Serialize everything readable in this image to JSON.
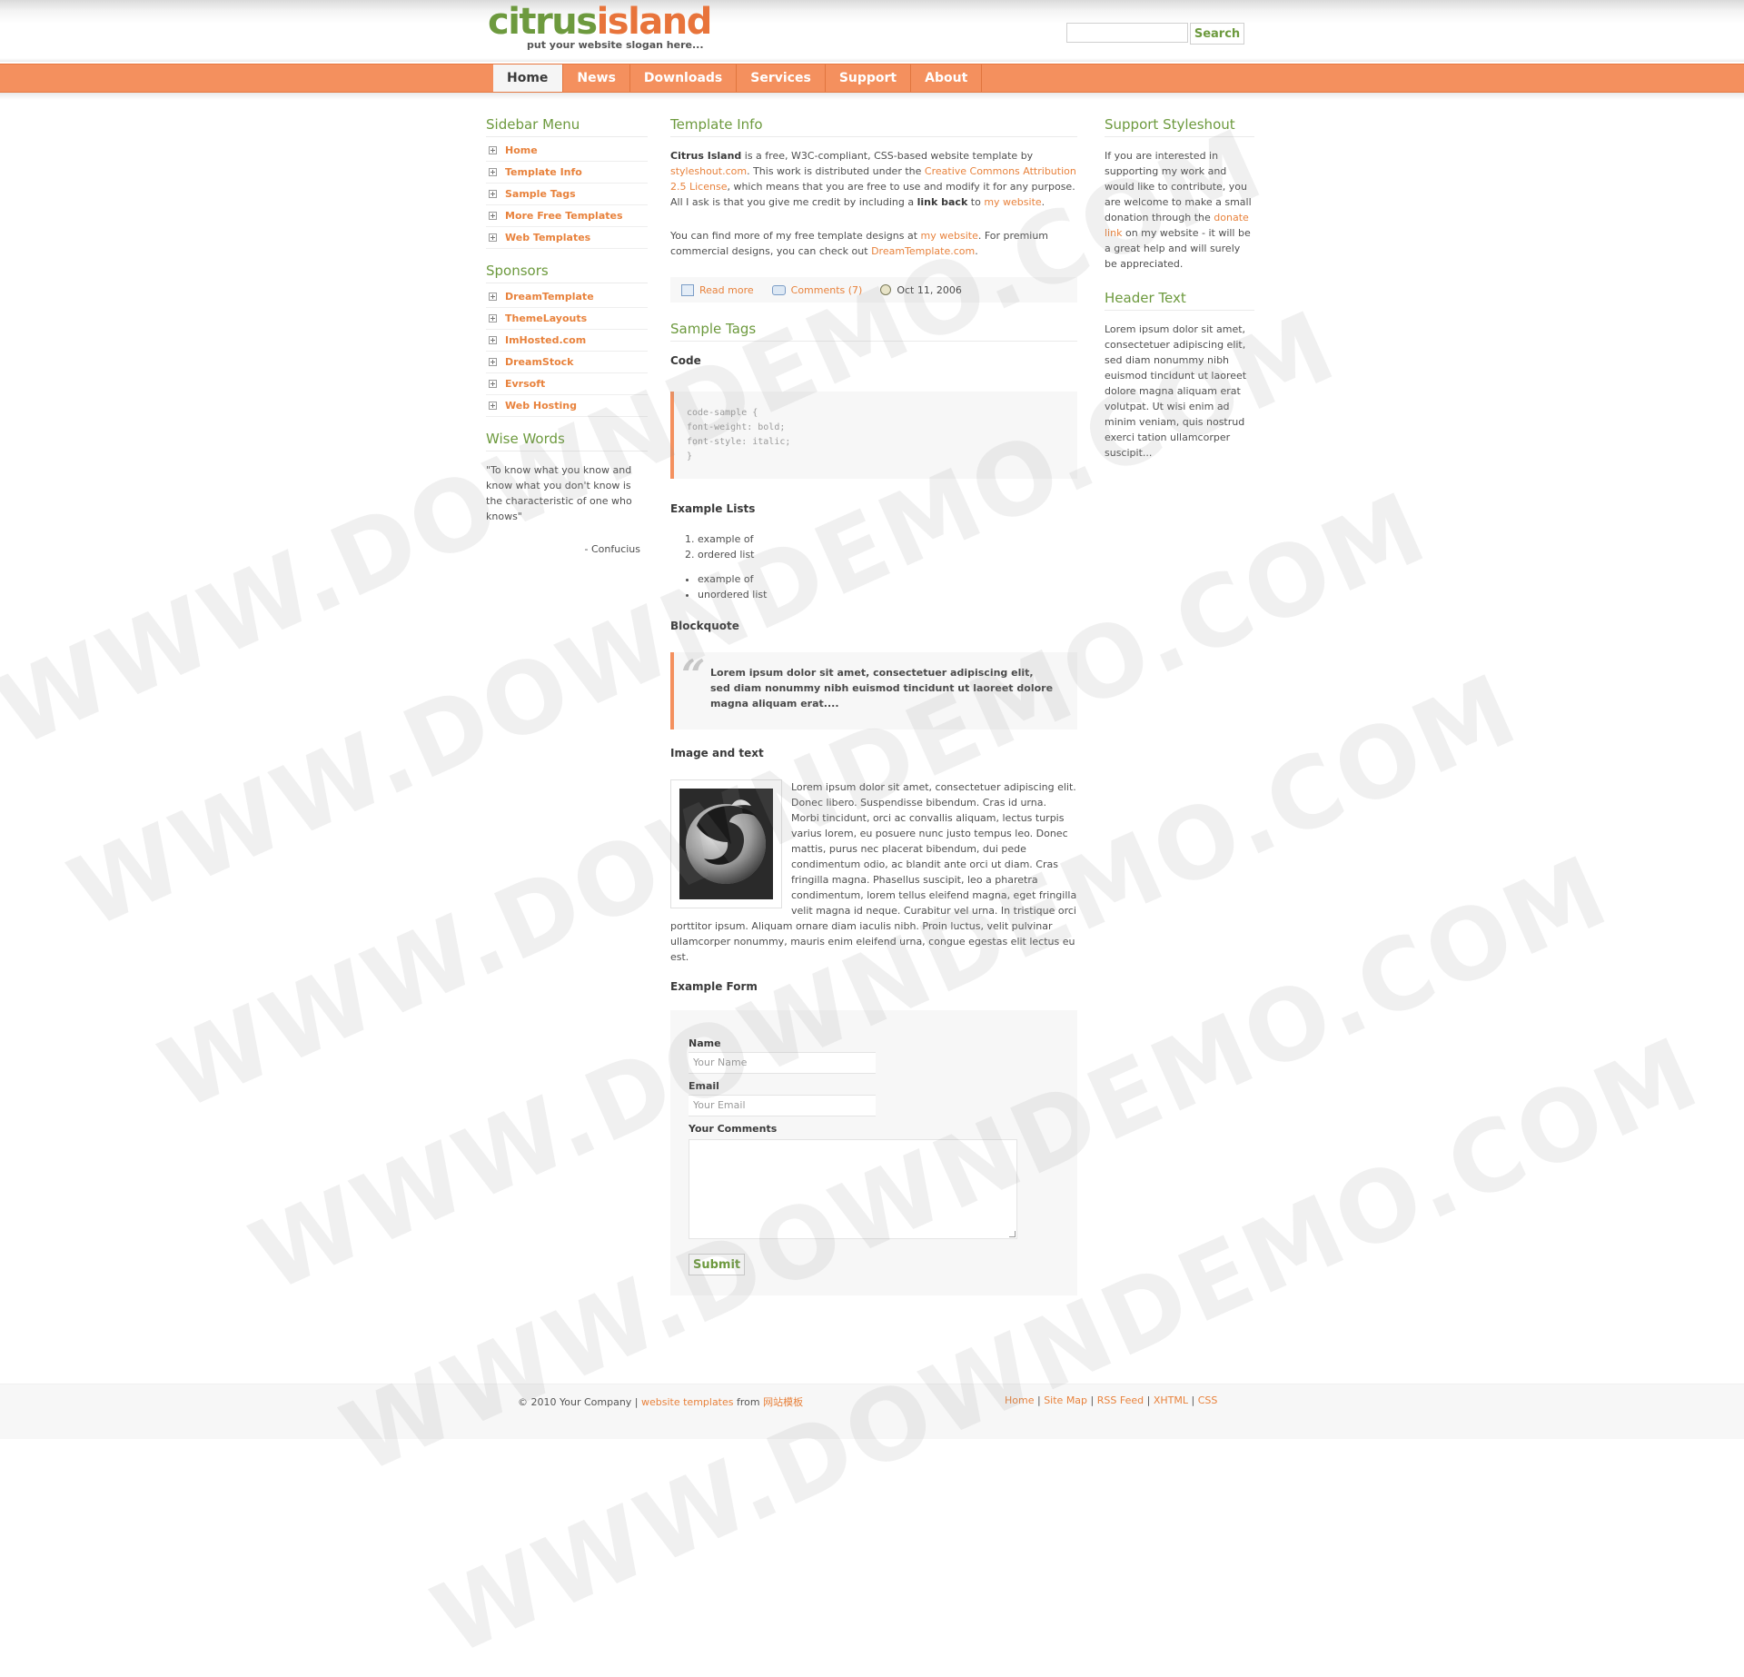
{
  "header": {
    "logo_part1": "citrus",
    "logo_part2": "island",
    "slogan": "put your website slogan here...",
    "search_button": "Search"
  },
  "nav": {
    "items": [
      "Home",
      "News",
      "Downloads",
      "Services",
      "Support",
      "About"
    ],
    "active": "Home"
  },
  "sidebar": {
    "menu_title": "Sidebar Menu",
    "menu": [
      "Home",
      "Template Info",
      "Sample Tags",
      "More Free Templates",
      "Web Templates"
    ],
    "sponsors_title": "Sponsors",
    "sponsors": [
      "DreamTemplate",
      "ThemeLayouts",
      "ImHosted.com",
      "DreamStock",
      "Evrsoft",
      "Web Hosting"
    ],
    "wise_title": "Wise Words",
    "quote": "\"To know what you know and know what you don't know is the characteristic of one who knows\"",
    "quote_author": "- Confucius"
  },
  "main": {
    "info_title": "Template Info",
    "p1": {
      "name": "Citrus Island",
      "t1": " is a free, W3C-compliant, CSS-based website template by ",
      "link1": "styleshout.com",
      "t2": ". This work is distributed under the ",
      "link2": "Creative Commons Attribution 2.5 License",
      "t3": ", which means that you are free to use and modify it for any purpose. All I ask is that you give me credit by including a ",
      "bold": "link back",
      "t4": " to ",
      "link3": "my website",
      "t5": "."
    },
    "p2": {
      "t1": "You can find more of my free template designs at ",
      "link1": "my website",
      "t2": ". For premium commercial designs, you can check out ",
      "link2": "DreamTemplate.com",
      "t3": "."
    },
    "meta": {
      "read_more": "Read more",
      "comments": "Comments (7)",
      "date": "Oct 11, 2006"
    },
    "tags_title": "Sample Tags",
    "code_title": "Code",
    "code_lines": [
      "code-sample {",
      "font-weight: bold;",
      "font-style: italic;",
      "}"
    ],
    "lists_title": "Example Lists",
    "ordered": [
      "example of",
      "ordered list"
    ],
    "unordered": [
      "example of",
      "unordered list"
    ],
    "blockquote_title": "Blockquote",
    "blockquote": "Lorem ipsum dolor sit amet, consectetuer adipiscing elit, sed diam nonummy nibh euismod tincidunt ut laoreet dolore magna aliquam erat....",
    "image_title": "Image and text",
    "image_text": "Lorem ipsum dolor sit amet, consectetuer adipiscing elit. Donec libero. Suspendisse bibendum. Cras id urna. Morbi tincidunt, orci ac convallis aliquam, lectus turpis varius lorem, eu posuere nunc justo tempus leo. Donec mattis, purus nec placerat bibendum, dui pede condimentum odio, ac blandit ante orci ut diam. Cras fringilla magna. Phasellus suscipit, leo a pharetra condimentum, lorem tellus eleifend magna, eget fringilla velit magna id neque. Curabitur vel urna. In tristique orci porttitor ipsum. Aliquam ornare diam iaculis nibh. Proin luctus, velit pulvinar ullamcorper nonummy, mauris enim eleifend urna, congue egestas elit lectus eu est.",
    "form_title": "Example Form",
    "form": {
      "name_label": "Name",
      "name_value": "Your Name",
      "email_label": "Email",
      "email_value": "Your Email",
      "comments_label": "Your Comments",
      "submit": "Submit"
    }
  },
  "right": {
    "support_title": "Support Styleshout",
    "support_t1": "If you are interested in supporting my work and would like to contribute, you are welcome to make a small donation through the ",
    "support_link": "donate link",
    "support_t2": " on my website - it will be a great help and will surely be appreciated.",
    "header_title": "Header Text",
    "header_text": "Lorem ipsum dolor sit amet, consectetuer adipiscing elit, sed diam nonummy nibh euismod tincidunt ut laoreet dolore magna aliquam erat volutpat. Ut wisi enim ad minim veniam, quis nostrud exerci tation ullamcorper suscipit..."
  },
  "footer": {
    "copyright": "© 2010 Your Company | ",
    "link1": "website templates",
    "from": " from ",
    "link2": "网站模板",
    "links": [
      "Home",
      "Site Map",
      "RSS Feed",
      "XHTML",
      "CSS"
    ],
    "separator": "|"
  },
  "watermark": "WWW.DOWNDEMO.COM",
  "colors": {
    "accent": "#f4905e",
    "green": "#6d9a3e",
    "link": "#e8823c"
  }
}
